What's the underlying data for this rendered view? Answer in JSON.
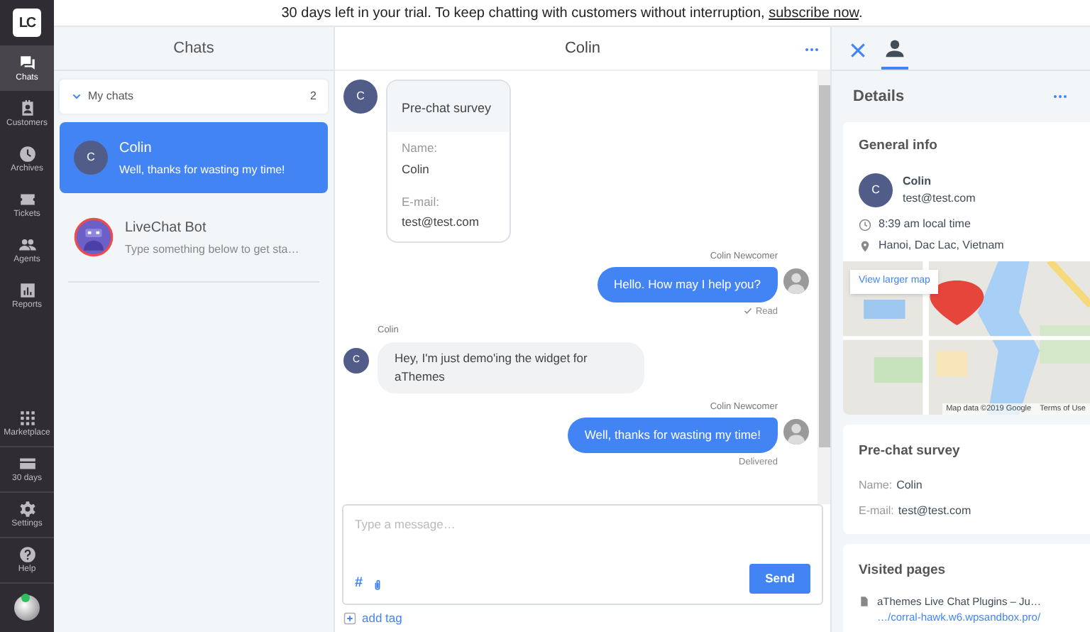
{
  "banner": {
    "text": "30 days left in your trial. To keep chatting with customers without interruption, ",
    "link": "subscribe now",
    "end": "."
  },
  "nav": {
    "logo": "LC",
    "items": [
      {
        "label": "Chats",
        "selected": true
      },
      {
        "label": "Customers",
        "selected": false
      },
      {
        "label": "Archives",
        "selected": false
      },
      {
        "label": "Tickets",
        "selected": false
      },
      {
        "label": "Agents",
        "selected": false
      },
      {
        "label": "Reports",
        "selected": false
      }
    ],
    "bottom_items": [
      {
        "label": "Marketplace"
      },
      {
        "label": "30 days"
      },
      {
        "label": "Settings"
      },
      {
        "label": "Help"
      }
    ],
    "online": true
  },
  "chat_list": {
    "title": "Chats",
    "group": {
      "label": "My chats",
      "count": "2",
      "expanded": true
    },
    "items": [
      {
        "name": "Colin",
        "preview": "Well, thanks for wasting my time!",
        "kind": "letter",
        "initial": "C",
        "selected": true
      },
      {
        "name": "LiveChat Bot",
        "preview": "Type something below to get sta…",
        "kind": "bot",
        "selected": false
      }
    ]
  },
  "conversation": {
    "title": "Colin",
    "survey": {
      "initial": "C",
      "title": "Pre-chat survey",
      "fields": [
        {
          "label": "Name:",
          "value": "Colin"
        },
        {
          "label": "E-mail:",
          "value": "test@test.com"
        }
      ]
    },
    "messages": [
      {
        "kind": "agent",
        "author": "Colin Newcomer",
        "text": "Hello. How may I help you?",
        "status": "Read",
        "read": true
      },
      {
        "kind": "customer",
        "author": "Colin",
        "initial": "C",
        "text": "Hey, I'm just demo'ing the widget for aThemes"
      },
      {
        "kind": "agent",
        "author": "Colin Newcomer",
        "text": "Well, thanks for wasting my time!",
        "status": "Delivered",
        "read": false
      }
    ],
    "composer": {
      "hashtag": "#",
      "placeholder": "Type a message…",
      "send": "Send",
      "add_tag": "add tag"
    }
  },
  "details": {
    "title": "Details",
    "general": {
      "title": "General info",
      "initial": "C",
      "name": "Colin",
      "email": "test@test.com",
      "local_time": "8:39 am local time",
      "location": "Hanoi, Dac Lac, Vietnam",
      "map": {
        "kind": "picture",
        "button": "View larger map",
        "attribution": "Map data ©2019 Google",
        "terms": "Terms of Use"
      }
    },
    "survey": {
      "title": "Pre-chat survey",
      "fields": [
        {
          "label": "Name:",
          "value": "Colin"
        },
        {
          "label": "E-mail:",
          "value": "test@test.com"
        }
      ]
    },
    "visited": {
      "title": "Visited pages",
      "pages": [
        {
          "title": "aThemes Live Chat Plugins – Ju…",
          "url": "…/corral-hawk.w6.wpsandbox.pro/"
        }
      ]
    }
  }
}
